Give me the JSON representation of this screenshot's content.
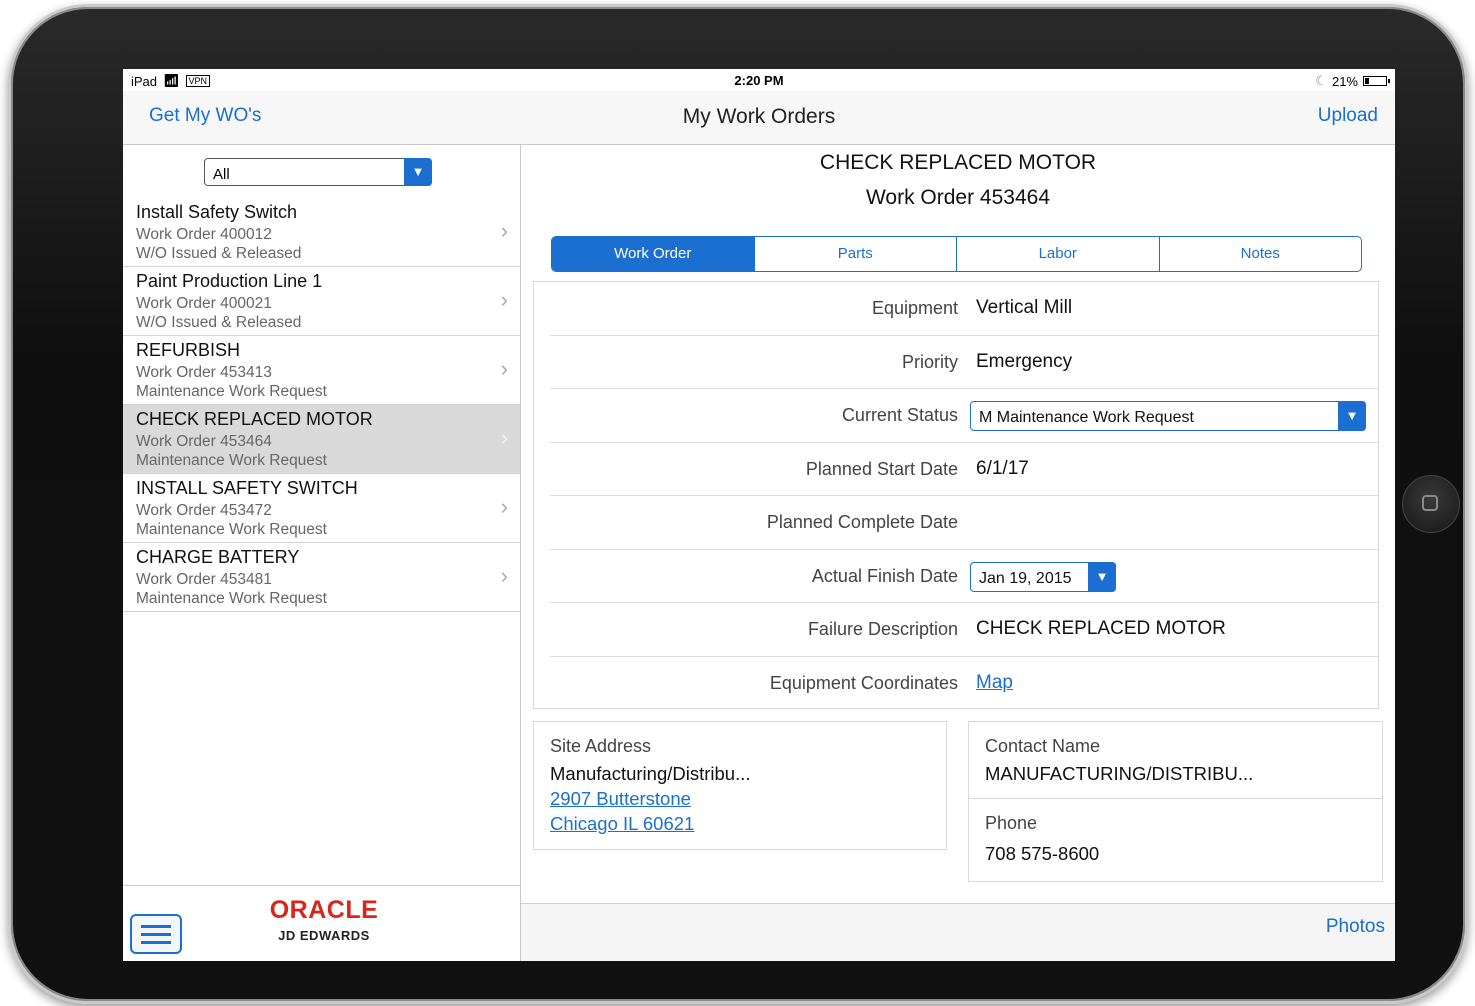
{
  "status_bar": {
    "device": "iPad",
    "vpn": "VPN",
    "time": "2:20 PM",
    "battery": "21%",
    "battery_level": 0.21
  },
  "navbar": {
    "left_button": "Get My WO's",
    "title": "My Work Orders",
    "right_button": "Upload"
  },
  "list": {
    "filter_value": "All",
    "items": [
      {
        "title": "Install Safety Switch",
        "wo": "Work Order 400012",
        "status": "W/O Issued & Released"
      },
      {
        "title": "Paint Production Line 1",
        "wo": "Work Order 400021",
        "status": "W/O Issued & Released"
      },
      {
        "title": "REFURBISH",
        "wo": "Work Order 453413",
        "status": "Maintenance Work Request"
      },
      {
        "title": "CHECK REPLACED MOTOR",
        "wo": "Work Order 453464",
        "status": "Maintenance Work Request"
      },
      {
        "title": "INSTALL SAFETY SWITCH",
        "wo": "Work Order 453472",
        "status": "Maintenance Work Request"
      },
      {
        "title": "CHARGE BATTERY",
        "wo": "Work Order 453481",
        "status": "Maintenance Work Request"
      }
    ],
    "selected_index": 3
  },
  "footer_left": {
    "brand": "ORACLE",
    "brand_sub": "JD EDWARDS"
  },
  "detail": {
    "title": "CHECK REPLACED MOTOR",
    "subtitle": "Work Order 453464",
    "tabs": [
      "Work Order",
      "Parts",
      "Labor",
      "Notes"
    ],
    "active_tab": 0,
    "fields": {
      "equipment_label": "Equipment",
      "equipment": "Vertical Mill",
      "priority_label": "Priority",
      "priority": "Emergency",
      "status_label": "Current Status",
      "status": "M Maintenance Work Request",
      "planned_start_label": "Planned Start Date",
      "planned_start": "6/1/17",
      "planned_complete_label": "Planned Complete Date",
      "planned_complete": "",
      "actual_finish_label": "Actual Finish Date",
      "actual_finish": "Jan 19, 2015",
      "failure_label": "Failure Description",
      "failure": "CHECK REPLACED MOTOR",
      "coords_label": "Equipment Coordinates",
      "coords_link": "Map"
    },
    "site": {
      "label": "Site Address",
      "name": "Manufacturing/Distribu...",
      "street": "2907 Butterstone",
      "city": "Chicago IL 60621"
    },
    "contact": {
      "label": "Contact Name",
      "name": "MANUFACTURING/DISTRIBU...",
      "phone_label": "Phone",
      "phone": "708 575-8600"
    },
    "footer_button": "Photos"
  },
  "colors": {
    "accent": "#1a6fd0",
    "brand": "#d9261c",
    "selected_row": "#d9d9d9"
  }
}
